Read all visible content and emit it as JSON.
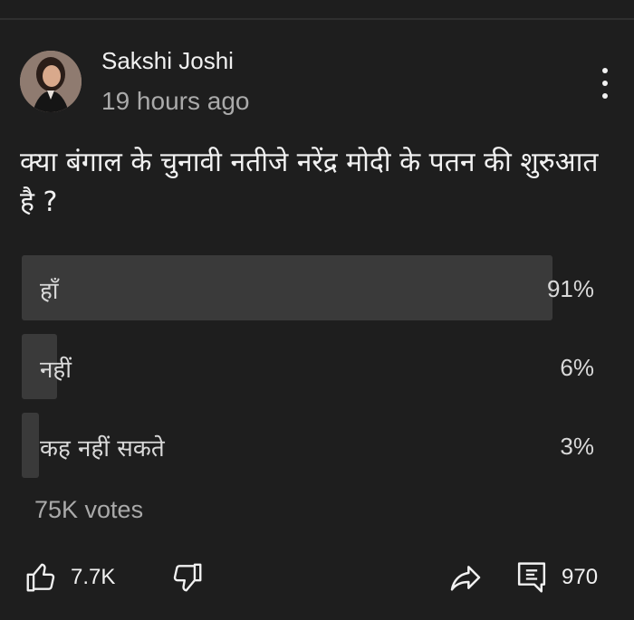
{
  "post": {
    "author": "Sakshi Joshi",
    "time": "19 hours ago",
    "question": "क्या बंगाल के चुनावी नतीजे नरेंद्र मोदी के पतन की शुरुआत है ?"
  },
  "poll": {
    "options": [
      {
        "label": "हाँ",
        "percent_label": "91%",
        "percent": 91
      },
      {
        "label": "नहीं",
        "percent_label": "6%",
        "percent": 6
      },
      {
        "label": "कह नहीं सकते",
        "percent_label": "3%",
        "percent": 3
      }
    ],
    "votes": "75K votes"
  },
  "actions": {
    "likes": "7.7K",
    "comments": "970"
  },
  "icons": [
    "more-vert-icon",
    "thumbs-up-icon",
    "thumbs-down-icon",
    "share-icon",
    "comment-icon"
  ],
  "colors": {
    "background": "#1e1e1e",
    "bar_fill": "#3a3a3a",
    "text_primary": "#f1f1f1",
    "text_secondary": "#aaaaaa"
  }
}
